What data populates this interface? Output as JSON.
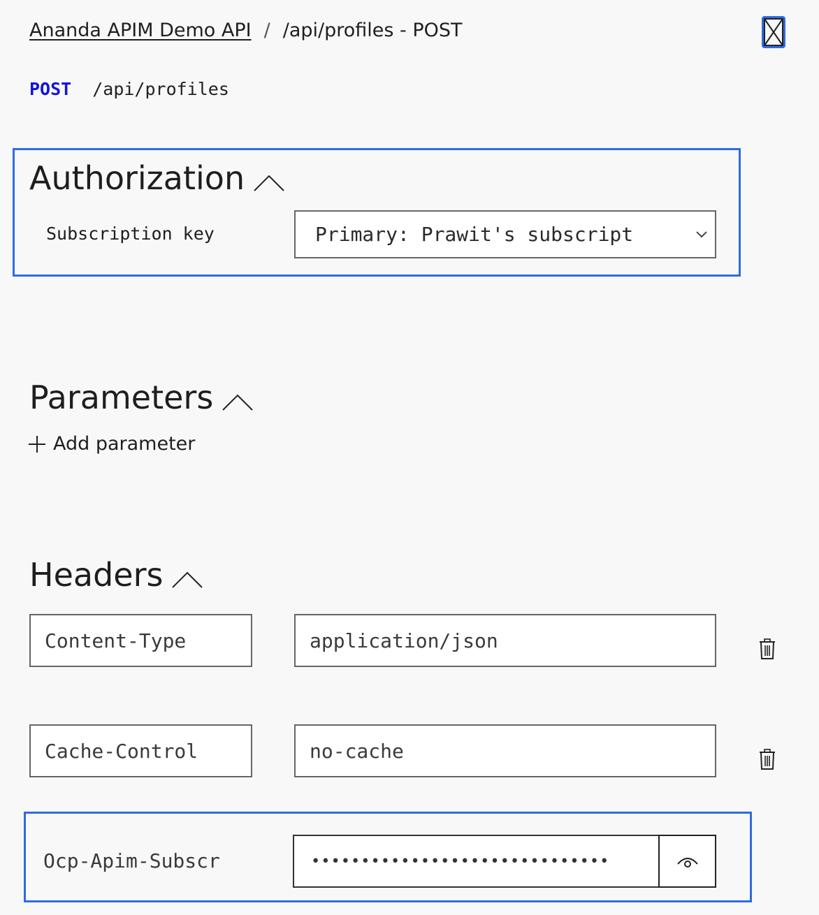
{
  "breadcrumb": {
    "api_name": "Ananda APIM Demo API",
    "separator": "/",
    "operation": "/api/profiles - POST"
  },
  "request": {
    "method": "POST",
    "path": "/api/profiles"
  },
  "authorization": {
    "title": "Authorization",
    "subscription_key_label": "Subscription key",
    "subscription_key_value": "Primary: Prawit's subscript"
  },
  "parameters": {
    "title": "Parameters",
    "add_label": "Add parameter"
  },
  "headers": {
    "title": "Headers",
    "rows": [
      {
        "name": "Content-Type",
        "value": "application/json"
      },
      {
        "name": "Cache-Control",
        "value": "no-cache"
      },
      {
        "name": "Ocp-Apim-Subscr",
        "value": "••••••••••••••••••••••••••••••"
      }
    ]
  },
  "icons": {
    "close": "close-icon",
    "collapse": "chevron-up-icon",
    "dropdown": "chevron-down-icon",
    "add": "plus-icon",
    "delete": "trash-icon",
    "reveal": "eye-icon"
  },
  "colors": {
    "accent": "#2f6be0",
    "method": "#1414d8",
    "background": "#f8f8f8"
  }
}
